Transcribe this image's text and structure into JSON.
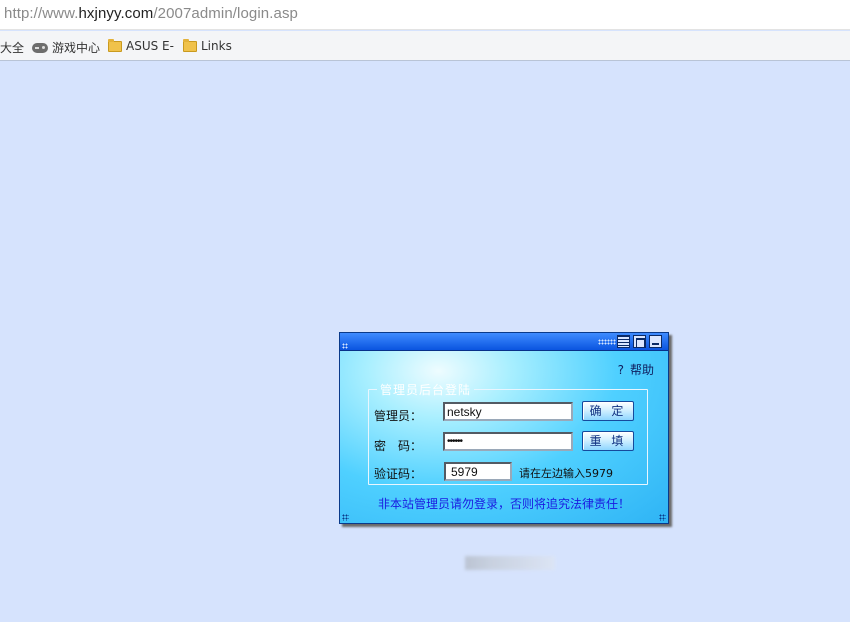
{
  "browser": {
    "url_scheme": "http://www.",
    "url_host": "hxjnyy.com",
    "url_path": "/2007admin/login.asp",
    "bookmarks": [
      {
        "label": "大全",
        "icon": "none"
      },
      {
        "label": "游戏中心",
        "icon": "gamepad-icon"
      },
      {
        "label": "ASUS E-",
        "icon": "folder-icon"
      },
      {
        "label": "Links",
        "icon": "folder-icon"
      }
    ]
  },
  "login": {
    "help": {
      "symbol": "?",
      "label": "帮助"
    },
    "legend": "管理员后台登陆",
    "username_label": "管理员：",
    "username_value": "netsky",
    "password_label": "密　码：",
    "password_value": "••••••",
    "captcha_label": "验证码：",
    "captcha_value": "5979",
    "captcha_hint": "请在左边输入5979",
    "confirm_button": "确 定",
    "reset_button": "重 填",
    "warning": "非本站管理员请勿登录，否则将追究法律责任！"
  },
  "colors": {
    "page_background": "#d6e3fd",
    "titlebar": "#0a54e0",
    "panel": "#2fb4f5",
    "warning_text": "#1a1ae0"
  }
}
